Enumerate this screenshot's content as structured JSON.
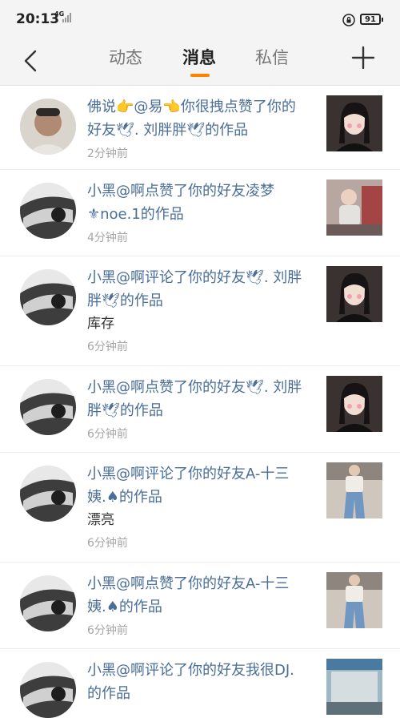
{
  "status_bar": {
    "time": "20:13",
    "network": "4G",
    "battery": "91"
  },
  "nav": {
    "tabs": [
      {
        "label": "动态",
        "active": false
      },
      {
        "label": "消息",
        "active": true
      },
      {
        "label": "私信",
        "active": false
      }
    ],
    "accent_color": "#ff8200"
  },
  "messages": [
    {
      "line1": "佛说👉@易👈你很拽点赞了你的",
      "line2": "好友🕊. 刘胖胖🕊的作品",
      "comment": "",
      "time": "2分钟前",
      "avatar_icon": "user-photo-avatar",
      "thumb_icon": "girl-portrait-thumbnail"
    },
    {
      "line1": "小黑@啊点赞了你的好友凌梦",
      "line2": "⚜noe.1的作品",
      "comment": "",
      "time": "4分钟前",
      "avatar_icon": "car-photo-avatar",
      "thumb_icon": "child-photo-thumbnail"
    },
    {
      "line1": "小黑@啊评论了你的好友🕊. 刘胖",
      "line2": "胖🕊的作品",
      "comment": "库存",
      "time": "6分钟前",
      "avatar_icon": "car-photo-avatar",
      "thumb_icon": "girl-portrait-thumbnail"
    },
    {
      "line1": "小黑@啊点赞了你的好友🕊. 刘胖",
      "line2": "胖🕊的作品",
      "comment": "",
      "time": "6分钟前",
      "avatar_icon": "car-photo-avatar",
      "thumb_icon": "girl-portrait-thumbnail"
    },
    {
      "line1": "小黑@啊评论了你的好友A-十三",
      "line2": "姨.♠的作品",
      "comment": "漂亮",
      "time": "6分钟前",
      "avatar_icon": "car-photo-avatar",
      "thumb_icon": "outfit-photo-thumbnail"
    },
    {
      "line1": "小黑@啊点赞了你的好友A-十三",
      "line2": "姨.♠的作品",
      "comment": "",
      "time": "6分钟前",
      "avatar_icon": "car-photo-avatar",
      "thumb_icon": "outfit-photo-thumbnail"
    },
    {
      "line1": "小黑@啊评论了你的好友我很DJ.",
      "line2": "的作品",
      "comment": "",
      "time": "",
      "avatar_icon": "car-photo-avatar",
      "thumb_icon": "street-photo-thumbnail"
    }
  ]
}
